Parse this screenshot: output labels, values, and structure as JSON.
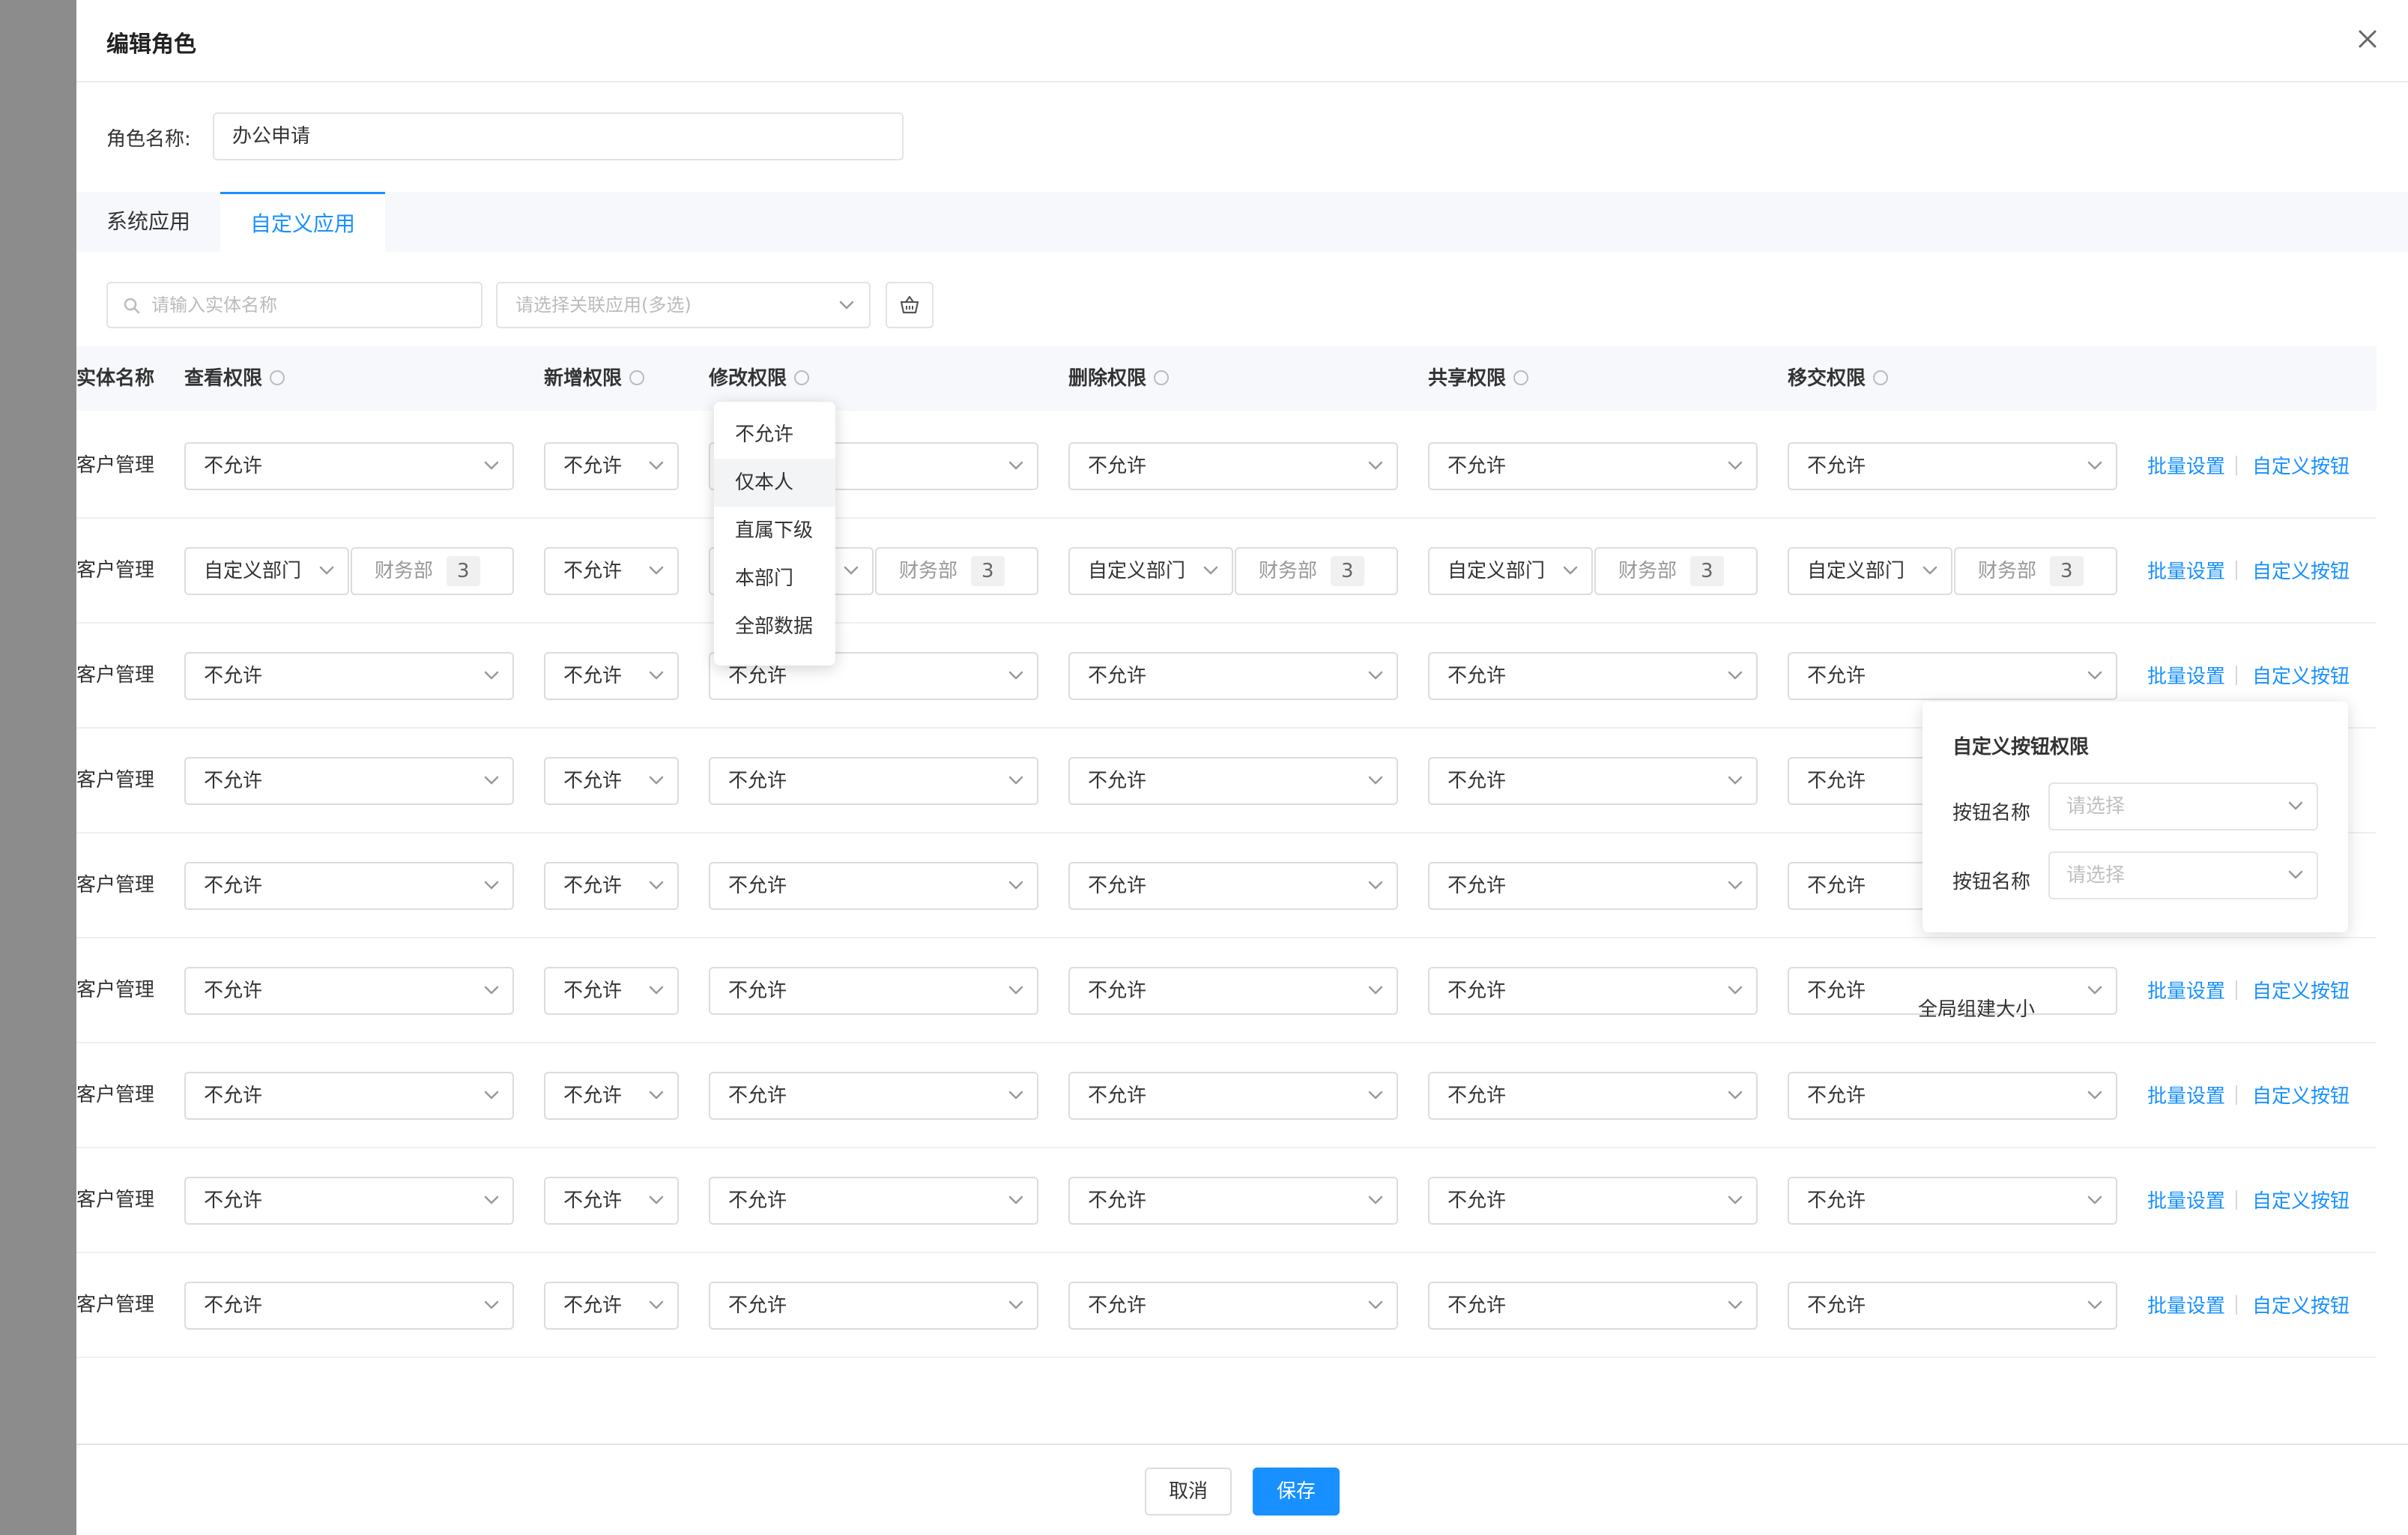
{
  "modal": {
    "title": "编辑角色"
  },
  "role": {
    "label": "角色名称:",
    "value": "办公申请"
  },
  "tabs": {
    "system": "系统应用",
    "custom": "自定义应用"
  },
  "filters": {
    "search_placeholder": "请输入实体名称",
    "app_placeholder": "请选择关联应用(多选)"
  },
  "columns": {
    "entity": "实体名称",
    "view": "查看权限",
    "add": "新增权限",
    "edit": "修改权限",
    "delete": "删除权限",
    "share": "共享权限",
    "transfer": "移交权限"
  },
  "rows": [
    {
      "entity": "客户管理",
      "view": "不允许",
      "add": "不允许",
      "edit": "",
      "delete": "不允许",
      "share": "不允许",
      "transfer": "不允许",
      "batch": "批量设置",
      "custom_btn": "自定义按钮"
    },
    {
      "entity": "客户管理",
      "view": "自定义部门",
      "view_dept": "财务部",
      "view_count": "3",
      "add": "不允许",
      "edit": "",
      "edit_dept": "财务部",
      "edit_count": "3",
      "delete": "自定义部门",
      "delete_dept": "财务部",
      "delete_count": "3",
      "share": "自定义部门",
      "share_dept": "财务部",
      "share_count": "3",
      "transfer": "自定义部门",
      "transfer_dept": "财务部",
      "transfer_count": "3",
      "batch": "批量设置",
      "custom_btn": "自定义按钮"
    },
    {
      "entity": "客户管理",
      "view": "不允许",
      "add": "不允许",
      "edit": "不允许",
      "delete": "不允许",
      "share": "不允许",
      "transfer": "不允许",
      "batch": "批量设置",
      "custom_btn": "自定义按钮"
    },
    {
      "entity": "客户管理",
      "view": "不允许",
      "add": "不允许",
      "edit": "不允许",
      "delete": "不允许",
      "share": "不允许",
      "transfer": "不允许"
    },
    {
      "entity": "客户管理",
      "view": "不允许",
      "add": "不允许",
      "edit": "不允许",
      "delete": "不允许",
      "share": "不允许",
      "transfer": "不允许"
    },
    {
      "entity": "客户管理",
      "view": "不允许",
      "add": "不允许",
      "edit": "不允许",
      "delete": "不允许",
      "share": "不允许",
      "transfer": "不允许",
      "batch": "批量设置",
      "custom_btn": "自定义按钮"
    },
    {
      "entity": "客户管理",
      "view": "不允许",
      "add": "不允许",
      "edit": "不允许",
      "delete": "不允许",
      "share": "不允许",
      "transfer": "不允许",
      "batch": "批量设置",
      "custom_btn": "自定义按钮"
    },
    {
      "entity": "客户管理",
      "view": "不允许",
      "add": "不允许",
      "edit": "不允许",
      "delete": "不允许",
      "share": "不允许",
      "transfer": "不允许",
      "batch": "批量设置",
      "custom_btn": "自定义按钮"
    },
    {
      "entity": "客户管理",
      "view": "不允许",
      "add": "不允许",
      "edit": "不允许",
      "delete": "不允许",
      "share": "不允许",
      "transfer": "不允许",
      "batch": "批量设置",
      "custom_btn": "自定义按钮"
    }
  ],
  "dropdown": {
    "options": [
      "不允许",
      "仅本人",
      "直属下级",
      "本部门",
      "全部数据"
    ],
    "highlighted": "仅本人"
  },
  "popover": {
    "title": "自定义按钮权限",
    "field1_label": "按钮名称",
    "field1_placeholder": "请选择",
    "field2_label": "按钮名称",
    "field2_placeholder": "请选择"
  },
  "floating_label": "全局组建大小",
  "footer": {
    "cancel": "取消",
    "save": "保存"
  },
  "icons": {
    "close": "close-icon",
    "search": "search-icon",
    "chevron": "chevron-down-icon",
    "basket": "basket-icon",
    "info": "info-icon"
  },
  "colors": {
    "primary": "#1890ff",
    "overlay": "#8c8c8c"
  }
}
